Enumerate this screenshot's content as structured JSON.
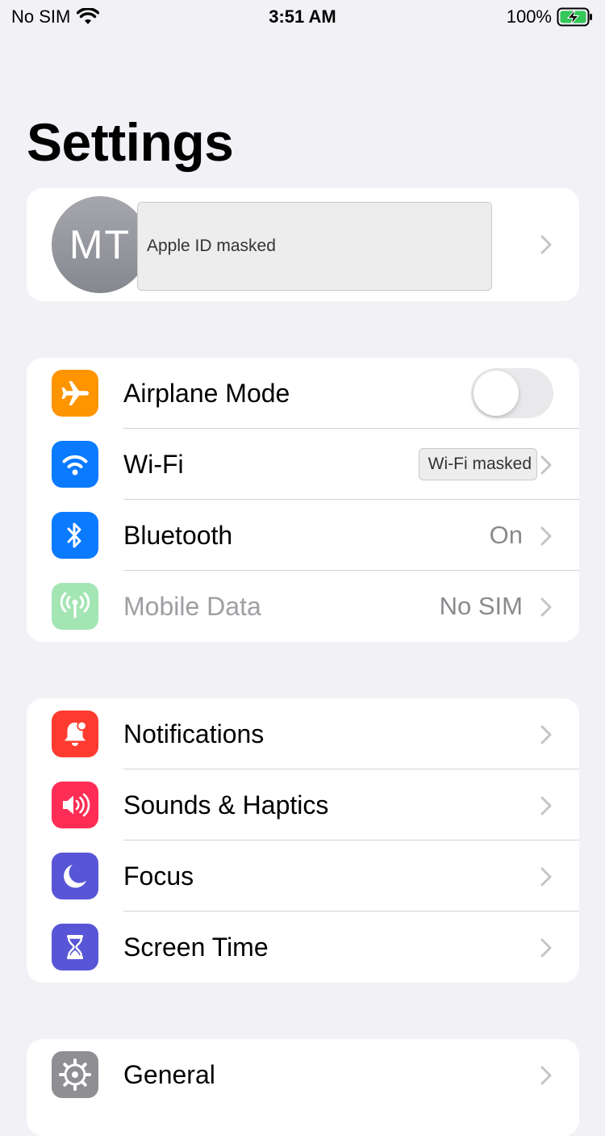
{
  "status_bar": {
    "carrier": "No SIM",
    "time": "3:51 AM",
    "battery": "100%"
  },
  "page": {
    "title": "Settings"
  },
  "profile": {
    "initials": "MT",
    "name_masked": "Apple ID masked"
  },
  "connectivity": {
    "airplane_mode": {
      "label": "Airplane Mode",
      "on": false,
      "icon": "airplane-icon",
      "color": "#fe9500"
    },
    "wifi": {
      "label": "Wi-Fi",
      "value_masked": "Wi-Fi masked",
      "icon": "wifi-icon",
      "color": "#0a7aff"
    },
    "bluetooth": {
      "label": "Bluetooth",
      "value": "On",
      "icon": "bluetooth-icon",
      "color": "#0a7aff"
    },
    "mobile_data": {
      "label": "Mobile Data",
      "value": "No SIM",
      "icon": "antenna-icon",
      "color": "#34c759"
    }
  },
  "notifications_group": {
    "notifications": {
      "label": "Notifications",
      "icon": "bell-icon",
      "color": "#ff3b30"
    },
    "sounds": {
      "label": "Sounds & Haptics",
      "icon": "speaker-icon",
      "color": "#ff2d55"
    },
    "focus": {
      "label": "Focus",
      "icon": "moon-icon",
      "color": "#5856d6"
    },
    "screen_time": {
      "label": "Screen Time",
      "icon": "hourglass-icon",
      "color": "#5856d6"
    }
  },
  "general_group": {
    "general": {
      "label": "General",
      "icon": "gear-icon",
      "color": "#8e8e93"
    }
  }
}
